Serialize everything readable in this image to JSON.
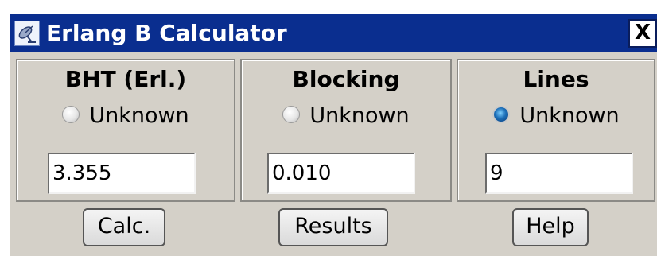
{
  "window": {
    "title": "Erlang B Calculator",
    "close_label": "X",
    "app_icon": "satellite-dish-icon"
  },
  "columns": [
    {
      "heading": "BHT (Erl.)",
      "radio_label": "Unknown",
      "radio_selected": false,
      "value": "3.355"
    },
    {
      "heading": "Blocking",
      "radio_label": "Unknown",
      "radio_selected": false,
      "value": "0.010"
    },
    {
      "heading": "Lines",
      "radio_label": "Unknown",
      "radio_selected": true,
      "value": "9"
    }
  ],
  "buttons": {
    "calc": "Calc.",
    "results": "Results",
    "help": "Help"
  },
  "colors": {
    "titlebar": "#0a2e8f",
    "window_background": "#d4d0c8",
    "radio_selected": "#1d6fb8"
  }
}
